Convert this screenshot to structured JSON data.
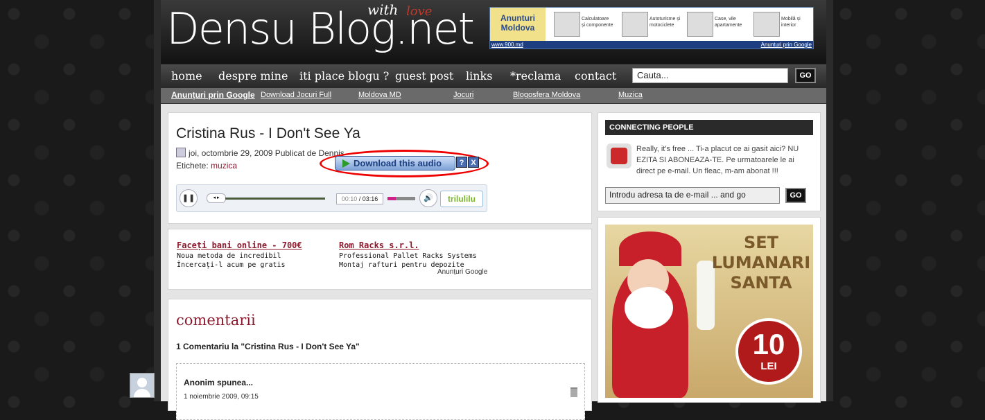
{
  "header": {
    "logo": "Densu Blog.net",
    "logo_with": "with",
    "logo_love": "love"
  },
  "banner": {
    "brand": "Anunturi Moldova",
    "categories": [
      "Calculatoare și componente",
      "Autoturisme și motociclete",
      "Case, vile apartamente",
      "Mobilă și interior"
    ],
    "footer_left": "www.900.md",
    "footer_right": "Anunturi prin Google"
  },
  "nav": {
    "items": [
      "home",
      "despre mine",
      "iti place blogu ?",
      "guest post",
      "links",
      "*reclama",
      "contact"
    ],
    "search_value": "Cauta...",
    "go_label": "GO"
  },
  "subnav": {
    "items": [
      "Anunțuri prin Google",
      "Download Jocuri Full",
      "Moldova MD",
      "Jocuri",
      "Blogosfera Moldova",
      "Muzica"
    ]
  },
  "post": {
    "title": "Cristina Rus - I Don't See Ya",
    "meta": "joi, octombrie 29, 2009 Publicat de Dennis",
    "tags_label": "Etichete:",
    "tag": "muzica",
    "download_label": "Download this audio",
    "help_icon_label": "?",
    "close_icon_label": "X"
  },
  "player": {
    "current_time": "00:10",
    "separator": "/",
    "total_time": "03:16",
    "brand": "trilulilu",
    "progress_fraction": 0.05,
    "volume_fraction": 0.3
  },
  "ads": {
    "items": [
      {
        "title": "Faceți bani online - 700€",
        "text": "Noua metoda de incredibil Încercați-l acum pe gratis"
      },
      {
        "title": "Rom Racks s.r.l.",
        "text": "Professional Pallet Racks Systems Montaj rafturi pentru depozite"
      }
    ],
    "footer": "Anunțuri Google"
  },
  "comments": {
    "heading": "comentarii",
    "count_text": "1 Comentariu la \"Cristina Rus - I Don't See Ya\"",
    "items": [
      {
        "author": "Anonim spunea...",
        "date": "1 noiembrie 2009, 09:15"
      }
    ]
  },
  "sidebar": {
    "heading": "CONNECTING PEOPLE",
    "text": "Really, it's free ... Ti-a placut ce ai gasit aici? NU EZITA SI ABONEAZA-TE. Pe urmatoarele le ai direct pe e-mail. Un fleac, m-am abonat !!!",
    "email_value": "Introdu adresa ta de e-mail ... and go",
    "go_label": "GO",
    "promo_title": "SET LUMANARI SANTA",
    "promo_price": "10",
    "promo_currency": "LEI"
  }
}
